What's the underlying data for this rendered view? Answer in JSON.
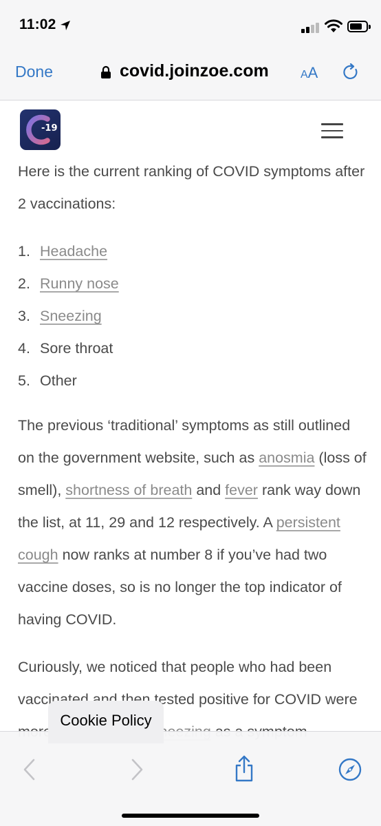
{
  "status_bar": {
    "time": "11:02",
    "icons": [
      "location-arrow-icon",
      "cellular-signal-icon",
      "wifi-icon",
      "battery-icon"
    ]
  },
  "browser": {
    "done_label": "Done",
    "url": "covid.joinzoe.com",
    "text_size_small": "A",
    "text_size_big": "A",
    "colors": {
      "accent": "#3478c6"
    }
  },
  "site": {
    "logo_text": "-19",
    "colors": {
      "logo_bg": "#1d2a5e",
      "logo_arc": "#6f6ad8",
      "logo_arc_accent": "#c9658f"
    }
  },
  "article": {
    "intro": "Here is the current ranking of COVID symptoms after 2 vaccinations:",
    "symptoms": [
      {
        "number": "1.",
        "label": "Headache",
        "link": true
      },
      {
        "number": "2.",
        "label": "Runny nose",
        "link": true
      },
      {
        "number": "3.",
        "label": "Sneezing",
        "link": true
      },
      {
        "number": "4.",
        "label": "Sore throat",
        "link": false
      },
      {
        "number": "5.",
        "label": "Other",
        "link": false
      }
    ],
    "para2": {
      "t1": "The previous ‘traditional’ symptoms as still outlined on the government website, such as ",
      "link_anosmia": "anosmia",
      "t2": " (loss of smell), ",
      "link_breath": "shortness of breath",
      "t3": " and ",
      "link_fever": "fever",
      "t4": " rank way down the list, at 11, 29 and 12 respectively. A ",
      "link_cough": "persistent cough",
      "t5": " now ranks at number 8 if you’ve had two vaccine doses, so is no longer the top indicator of having COVID."
    },
    "para3": {
      "t1": "Curiously, we noticed that people who had been vaccinated and then tested positive for COVID were more likely to report ",
      "link_sneezing": "sneezing",
      "t2": " as a symptom compared with those without a"
    }
  },
  "cookie_policy_label": "Cookie Policy",
  "toolbar_icons": [
    "back-icon",
    "forward-icon",
    "share-icon",
    "compass-icon"
  ]
}
